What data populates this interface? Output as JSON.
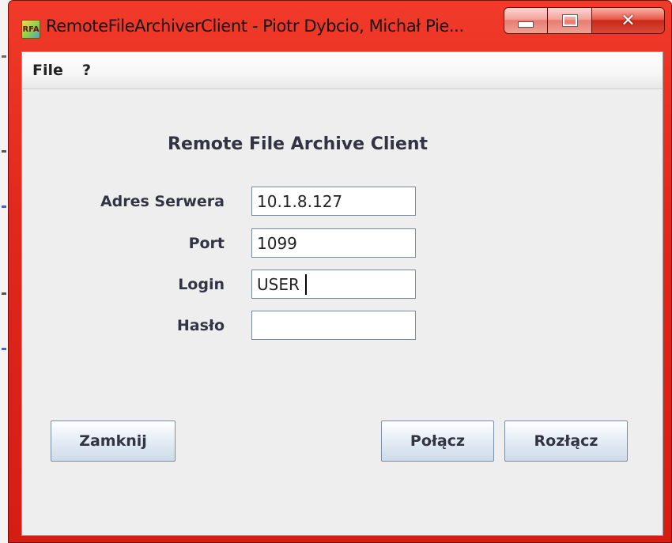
{
  "window": {
    "title": "RemoteFileArchiverClient - Piotr Dybcio, Michał Pie...",
    "icon_text": "RFA",
    "icon": "app-icon"
  },
  "menu": {
    "items": [
      {
        "label": "File"
      },
      {
        "label": "?"
      }
    ]
  },
  "form": {
    "heading": "Remote File Archive Client",
    "fields": [
      {
        "label": "Adres Serwera",
        "value": "10.1.8.127"
      },
      {
        "label": "Port",
        "value": "1099"
      },
      {
        "label": "Login",
        "value": "USER"
      },
      {
        "label": "Hasło",
        "value": ""
      }
    ]
  },
  "buttons": {
    "close": "Zamknij",
    "connect": "Połącz",
    "disconnect": "Rozłącz"
  },
  "colors": {
    "title_bar": "#e0281c",
    "client_bg": "#eeeeee",
    "label_text": "#333344"
  }
}
